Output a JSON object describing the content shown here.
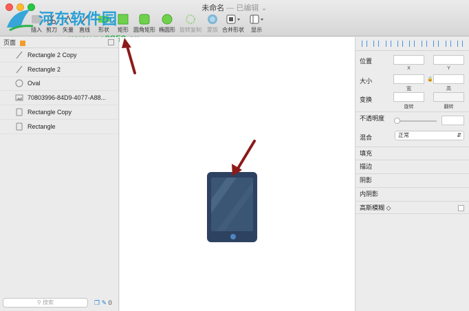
{
  "window": {
    "title": "未命名",
    "title_suffix": "— 已编辑 ⌄"
  },
  "toolbar": {
    "items": [
      {
        "label": "插入",
        "icon": "insert-icon"
      },
      {
        "label": "剪刀",
        "icon": "scissors-icon"
      },
      {
        "label": "矢量",
        "icon": "vector-icon"
      },
      {
        "label": "直线",
        "icon": "line-icon"
      },
      {
        "label": "形状",
        "icon": "shape-icon"
      },
      {
        "label": "矩形",
        "icon": "rectangle-icon"
      },
      {
        "label": "圆角矩形",
        "icon": "rounded-rectangle-icon"
      },
      {
        "label": "椭圆形",
        "icon": "oval-icon"
      },
      {
        "label": "旋转复制",
        "icon": "rotate-copy-icon"
      },
      {
        "label": "蒙版",
        "icon": "mask-icon"
      },
      {
        "label": "合并形状",
        "icon": "combine-shapes-icon"
      },
      {
        "label": "显示",
        "icon": "view-icon"
      }
    ]
  },
  "watermark": {
    "text": "河东软件园",
    "url": "www.pc0359.cn"
  },
  "layers": {
    "header": "页面",
    "items": [
      {
        "name": "Rectangle 2 Copy",
        "icon": "line-layer-icon"
      },
      {
        "name": "Rectangle 2",
        "icon": "line-layer-icon"
      },
      {
        "name": "Oval",
        "icon": "oval-layer-icon"
      },
      {
        "name": "70803996-84D9-4077-A88...",
        "icon": "image-layer-icon"
      },
      {
        "name": "Rectangle Copy",
        "icon": "rectangle-layer-icon"
      },
      {
        "name": "Rectangle",
        "icon": "rectangle-layer-icon"
      }
    ],
    "search_placeholder": "搜索",
    "footer_count": "0"
  },
  "inspector": {
    "position_label": "位置",
    "x_label": "X",
    "y_label": "Y",
    "size_label": "大小",
    "width_label": "宽",
    "height_label": "高",
    "transform_label": "变换",
    "rotate_label": "旋转",
    "flip_label": "翻转",
    "opacity_label": "不透明度",
    "blend_label": "混合",
    "blend_value": "正常",
    "fill_label": "填充",
    "border_label": "描边",
    "shadow_label": "阴影",
    "inner_shadow_label": "内阴影",
    "blur_label": "高斯模糊 ◇"
  },
  "colors": {
    "tablet_body": "#2d4260",
    "tablet_screen": "#3b5675",
    "arrow": "#8b1a1a",
    "accent": "#4a90e2"
  }
}
